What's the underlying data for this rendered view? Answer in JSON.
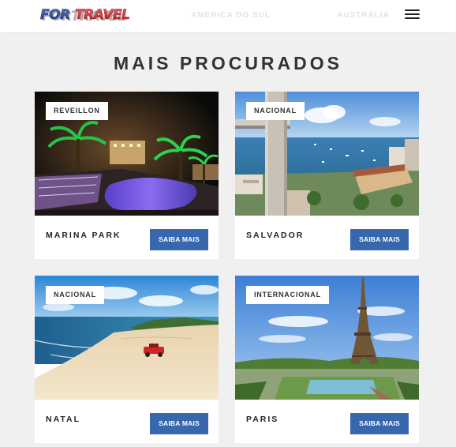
{
  "header": {
    "logo_text": "FORTRAVEL",
    "nav": [
      "AMERICA DO SUL",
      "AUSTRÁLIA"
    ],
    "menu_icon": "hamburger-menu-icon"
  },
  "section": {
    "title": "MAIS PROCURADOS"
  },
  "cards": [
    {
      "tag": "REVEILLON",
      "name": "MARINA PARK",
      "button": "SAIBA MAIS"
    },
    {
      "tag": "NACIONAL",
      "name": "SALVADOR",
      "button": "SAIBA MAIS"
    },
    {
      "tag": "NACIONAL",
      "name": "NATAL",
      "button": "SAIBA MAIS"
    },
    {
      "tag": "INTERNACIONAL",
      "name": "PARIS",
      "button": "SAIBA MAIS"
    }
  ],
  "colors": {
    "page_bg": "#f0f0f0",
    "button": "#3767ad",
    "logo_red": "#d8262c",
    "logo_blue": "#1f3f8f"
  }
}
